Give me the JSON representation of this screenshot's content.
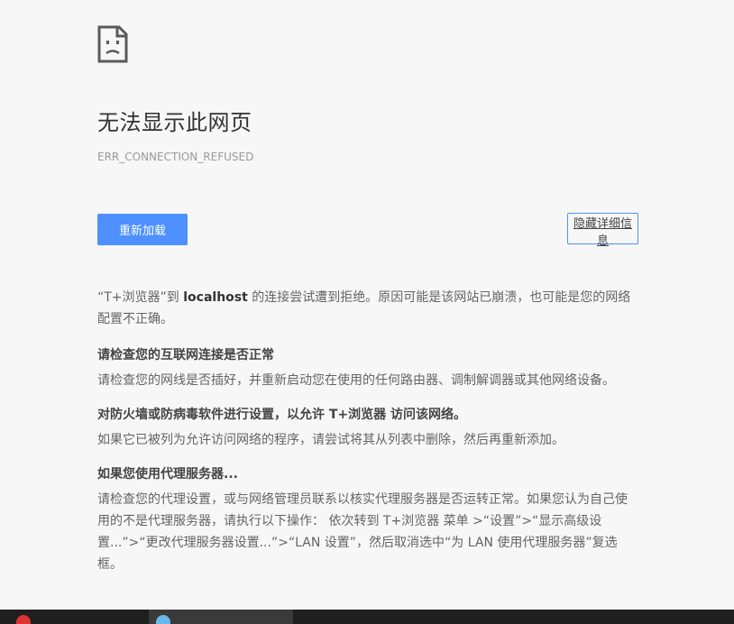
{
  "error": {
    "title": "无法显示此网页",
    "code": "ERR_CONNECTION_REFUSED"
  },
  "buttons": {
    "reload_label": "重新加载",
    "details_label": "隐藏详细信息"
  },
  "intro": {
    "prefix": "“T+浏览器”到 ",
    "host": "localhost",
    "suffix": " 的连接尝试遭到拒绝。原因可能是该网站已崩溃，也可能是您的网络配置不正确。"
  },
  "sections": [
    {
      "title": "请检查您的互联网连接是否正常",
      "body": "请检查您的网线是否插好，并重新启动您在使用的任何路由器、调制解调器或其他网络设备。"
    },
    {
      "title": "对防火墙或防病毒软件进行设置，以允许 T+浏览器 访问该网络。",
      "body": "如果它已被列为允许访问网络的程序，请尝试将其从列表中删除，然后再重新添加。"
    },
    {
      "title": "如果您使用代理服务器...",
      "body": "请检查您的代理设置，或与网络管理员联系以核实代理服务器是否运转正常。如果您认为自己使用的不是代理服务器，请执行以下操作： 依次转到 T+浏览器 菜单 >“设置”>“显示高级设置...”>“更改代理服务器设置...”>“LAN 设置”，然后取消选中“为 LAN 使用代理服务器”复选框。"
    }
  ],
  "colors": {
    "accent": "#4d90fe",
    "background": "#f7f7f7",
    "taskbar": "#1f1f1f"
  },
  "icons": {
    "error": "sad-document-icon"
  }
}
